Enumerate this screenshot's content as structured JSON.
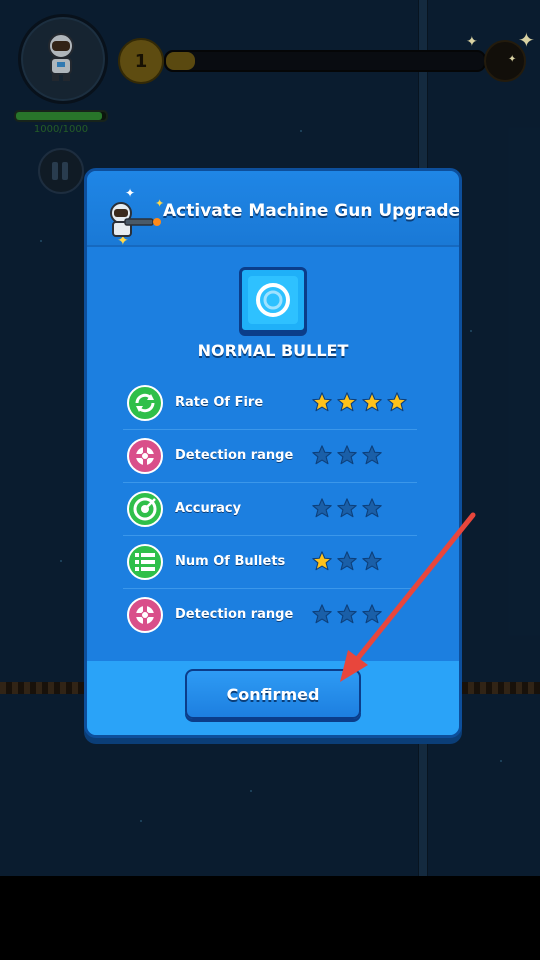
{
  "hud": {
    "hp_text": "1000/1000",
    "hp_fraction": 0.95,
    "level": "1",
    "xp_fraction": 0.09
  },
  "dialog": {
    "title": "Activate Machine Gun Upgrade",
    "bullet_name": "NORMAL BULLET",
    "stats": [
      {
        "label": "Rate Of Fire",
        "icon": "rate-of-fire-icon",
        "filled": 4,
        "total": 4,
        "icon_color": "#2fbf4a"
      },
      {
        "label": "Detection range",
        "icon": "detection-range-icon",
        "filled": 0,
        "total": 3,
        "icon_color": "#d94f8a"
      },
      {
        "label": "Accuracy",
        "icon": "accuracy-icon",
        "filled": 0,
        "total": 3,
        "icon_color": "#2fbf4a"
      },
      {
        "label": "Num Of Bullets",
        "icon": "num-of-bullets-icon",
        "filled": 1,
        "total": 3,
        "icon_color": "#2fbf4a"
      },
      {
        "label": "Detection range",
        "icon": "detection-range-icon",
        "filled": 0,
        "total": 3,
        "icon_color": "#d94f8a"
      }
    ],
    "confirm_label": "Confirmed"
  },
  "colors": {
    "star_filled": "#ffc21a",
    "star_empty": "#1a5fa8",
    "annotation_arrow": "#e8463c"
  }
}
